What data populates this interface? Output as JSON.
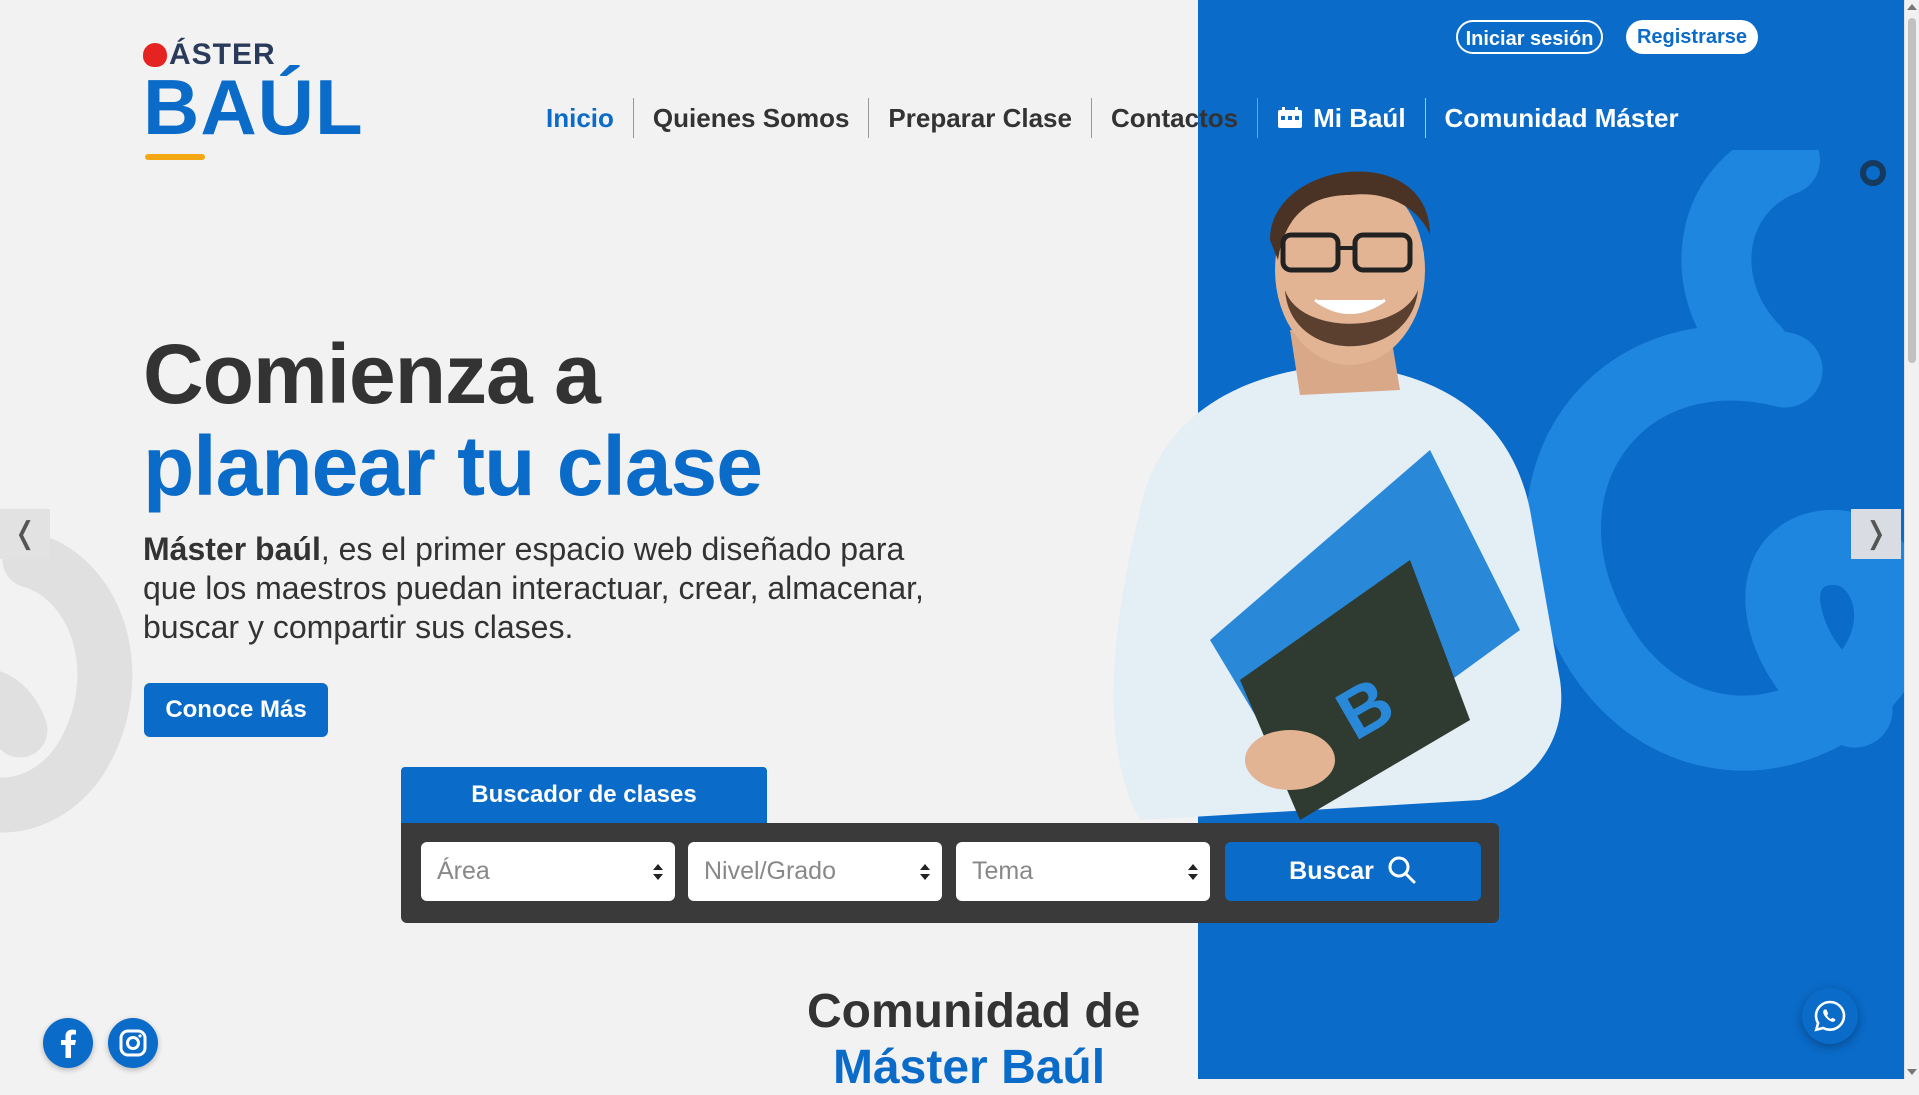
{
  "brand": {
    "logo_top": "ÁSTER",
    "logo_bottom": "BAÚL"
  },
  "auth": {
    "login_label": "Iniciar sesión",
    "register_label": "Registrarse"
  },
  "nav": {
    "items": [
      {
        "label": "Inicio",
        "active": true
      },
      {
        "label": "Quienes Somos"
      },
      {
        "label": "Preparar Clase"
      },
      {
        "label": "Contactos"
      },
      {
        "label": "Mi Baúl",
        "icon": "calendar-icon"
      },
      {
        "label": "Comunidad Máster"
      }
    ]
  },
  "hero": {
    "title_line1": "Comienza a",
    "title_line2": "planear tu clase",
    "desc_bold": "Máster baúl",
    "desc_rest": ", es el primer espacio web diseñado para que los maestros puedan interactuar, crear, almacenar, buscar y compartir sus clases.",
    "cta_label": "Conoce Más"
  },
  "carousel": {
    "prev": "❬",
    "next": "❭"
  },
  "search": {
    "tab_label": "Buscador de clases",
    "area_placeholder": "Área",
    "nivel_placeholder": "Nivel/Grado",
    "tema_placeholder": "Tema",
    "button_label": "Buscar"
  },
  "community": {
    "line1": "Comunidad de",
    "line2": "Máster Baúl"
  },
  "colors": {
    "brand_blue": "#0a6bc9",
    "dark": "#333333",
    "search_bg": "#3a3a3a"
  },
  "icons": [
    "calendar-icon",
    "search-icon",
    "facebook-icon",
    "instagram-icon",
    "whatsapp-icon",
    "chevron-left-icon",
    "chevron-right-icon"
  ]
}
